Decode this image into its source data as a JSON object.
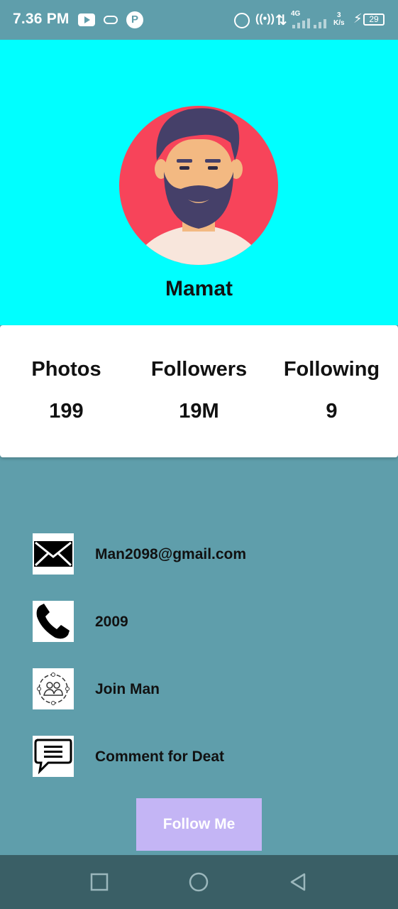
{
  "status_bar": {
    "time": "7.36 PM",
    "network_type": "4G",
    "speed_value": "3",
    "speed_unit": "K/s",
    "battery": "29"
  },
  "profile": {
    "name": "Mamat",
    "avatar_bg": "#f7445a"
  },
  "stats": [
    {
      "label": "Photos",
      "value": "199"
    },
    {
      "label": "Followers",
      "value": "19M"
    },
    {
      "label": "Following",
      "value": "9"
    }
  ],
  "info": [
    {
      "icon": "mail-icon",
      "text": "Man2098@gmail.com"
    },
    {
      "icon": "phone-icon",
      "text": "2009"
    },
    {
      "icon": "group-icon",
      "text": "Join Man"
    },
    {
      "icon": "comment-icon",
      "text": "Comment for Deat"
    }
  ],
  "follow_button": {
    "label": "Follow Me",
    "color": "#c4b5f5"
  },
  "colors": {
    "header": "#00ffff",
    "background": "#5f9eab",
    "nav_bar": "#3a5f66"
  }
}
